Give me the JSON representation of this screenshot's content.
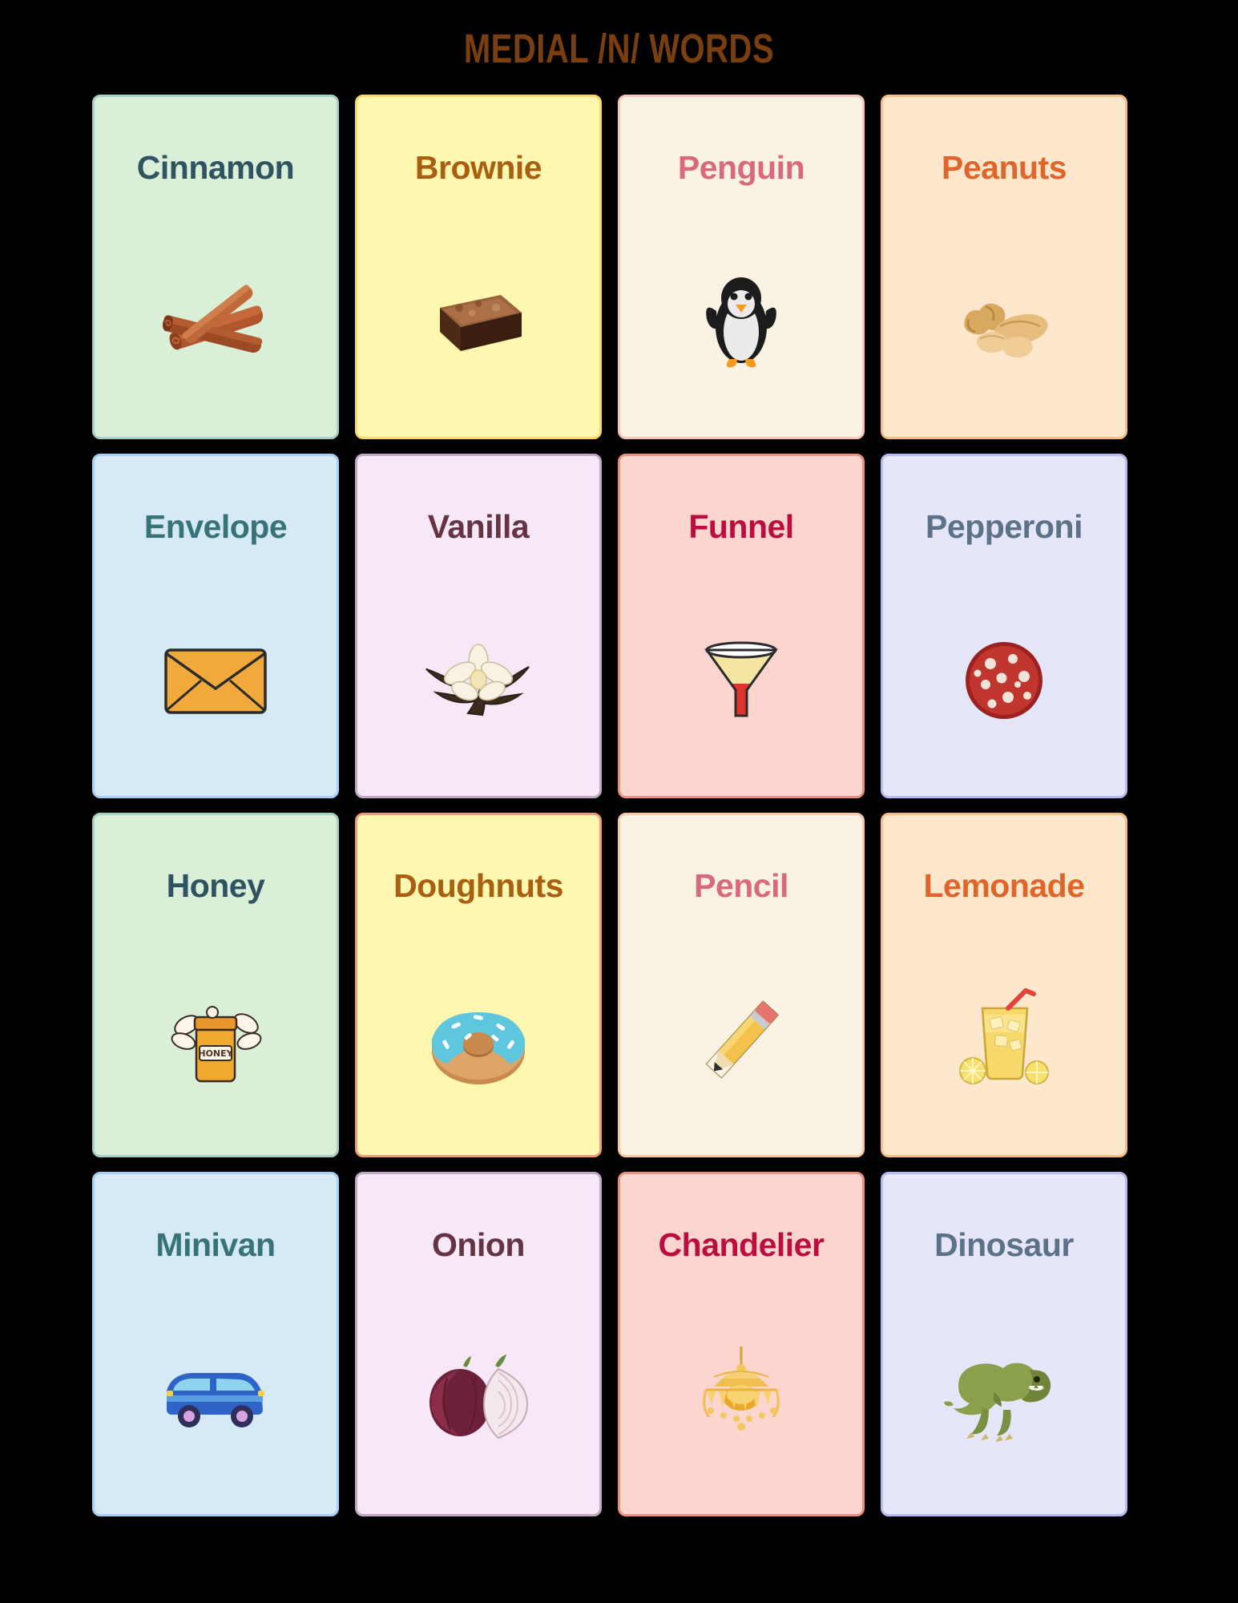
{
  "header": {
    "title": "MEDIAL /N/ WORDS",
    "title_color": "#7a3f10"
  },
  "background_color": "#000000",
  "grid": {
    "columns": 4,
    "rows": 4
  },
  "cards": [
    {
      "label": "Cinnamon",
      "image": "cinnamon-sticks",
      "bg": "#d9efd8",
      "border": "#a7cfc3",
      "text": "#2f5360"
    },
    {
      "label": "Brownie",
      "image": "brownie-square",
      "bg": "#fdf7b0",
      "border": "#fbd767",
      "text": "#a85f10"
    },
    {
      "label": "Penguin",
      "image": "penguin",
      "bg": "#faf3e3",
      "border": "#f8c6b8",
      "text": "#d9697e"
    },
    {
      "label": "Peanuts",
      "image": "peanuts",
      "bg": "#fde8cd",
      "border": "#f6bd84",
      "text": "#e0652a"
    },
    {
      "label": "Envelope",
      "image": "envelope",
      "bg": "#d5eaf4",
      "border": "#a9cdf3",
      "text": "#36747a"
    },
    {
      "label": "Vanilla",
      "image": "vanilla-flower",
      "bg": "#f6e8f7",
      "border": "#bfa9c4",
      "text": "#663344"
    },
    {
      "label": "Funnel",
      "image": "funnel",
      "bg": "#fbd5ce",
      "border": "#eb9182",
      "text": "#bb0d3f"
    },
    {
      "label": "Pepperoni",
      "image": "pepperoni-slice",
      "bg": "#e6e6fb",
      "border": "#b8b8f5",
      "text": "#5b7289"
    },
    {
      "label": "Honey",
      "image": "honey-jar",
      "bg": "#d9efd8",
      "border": "#a7cfc3",
      "text": "#2f5360"
    },
    {
      "label": "Doughnuts",
      "image": "donut",
      "bg": "#fdf7b0",
      "border": "#f09a7c",
      "text": "#a85f10"
    },
    {
      "label": "Pencil",
      "image": "pencil",
      "bg": "#faf3e3",
      "border": "#f9c8a5",
      "text": "#d9697e"
    },
    {
      "label": "Lemonade",
      "image": "lemonade-glass",
      "bg": "#fde8cd",
      "border": "#f6bd84",
      "text": "#e0652a"
    },
    {
      "label": "Minivan",
      "image": "minivan",
      "bg": "#d5eaf4",
      "border": "#a9cdf3",
      "text": "#36747a"
    },
    {
      "label": "Onion",
      "image": "onion",
      "bg": "#f6e8f7",
      "border": "#bfa9c4",
      "text": "#663344"
    },
    {
      "label": "Chandelier",
      "image": "chandelier",
      "bg": "#fbd5ce",
      "border": "#eb9182",
      "text": "#bb0d3f"
    },
    {
      "label": "Dinosaur",
      "image": "dinosaur",
      "bg": "#e6e6fb",
      "border": "#b8b8f5",
      "text": "#5b7289"
    }
  ]
}
